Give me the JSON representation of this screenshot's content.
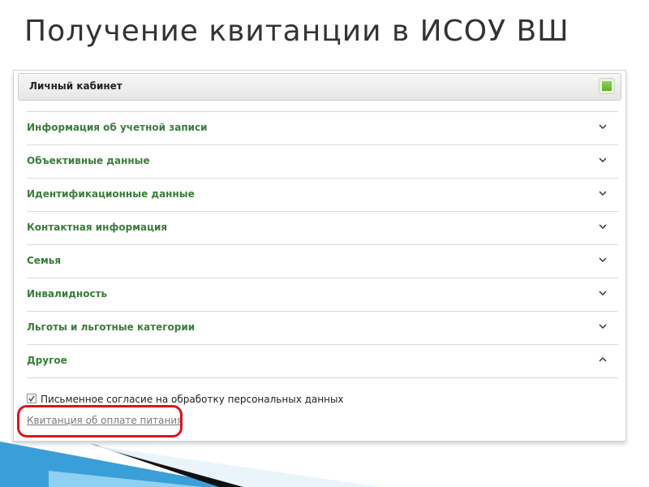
{
  "slide": {
    "title": "Получение квитанции в ИСОУ ВШ"
  },
  "panel": {
    "title": "Личный кабинет"
  },
  "accordion": {
    "items": [
      {
        "label": "Информация об учетной записи",
        "icon": "chevron-down-icon"
      },
      {
        "label": "Объективные данные",
        "icon": "chevron-down-icon"
      },
      {
        "label": "Идентификационные данные",
        "icon": "chevron-down-icon"
      },
      {
        "label": "Контактная информация",
        "icon": "chevron-down-icon"
      },
      {
        "label": "Семья",
        "icon": "chevron-down-icon"
      },
      {
        "label": "Инвалидность",
        "icon": "chevron-down-icon"
      },
      {
        "label": "Льготы и льготные категории",
        "icon": "chevron-down-icon"
      },
      {
        "label": "Другое",
        "icon": "chevron-up-icon"
      }
    ]
  },
  "other_section": {
    "consent_label": "Письменное согласие на обработку персональных данных",
    "consent_checked": true,
    "receipt_link": "Квитанция об оплате питания"
  },
  "colors": {
    "section_label": "#3a7d3a",
    "highlight": "#e0141c",
    "accent_green": "#5fae2a",
    "decor_blue": "#3a9fd8"
  }
}
